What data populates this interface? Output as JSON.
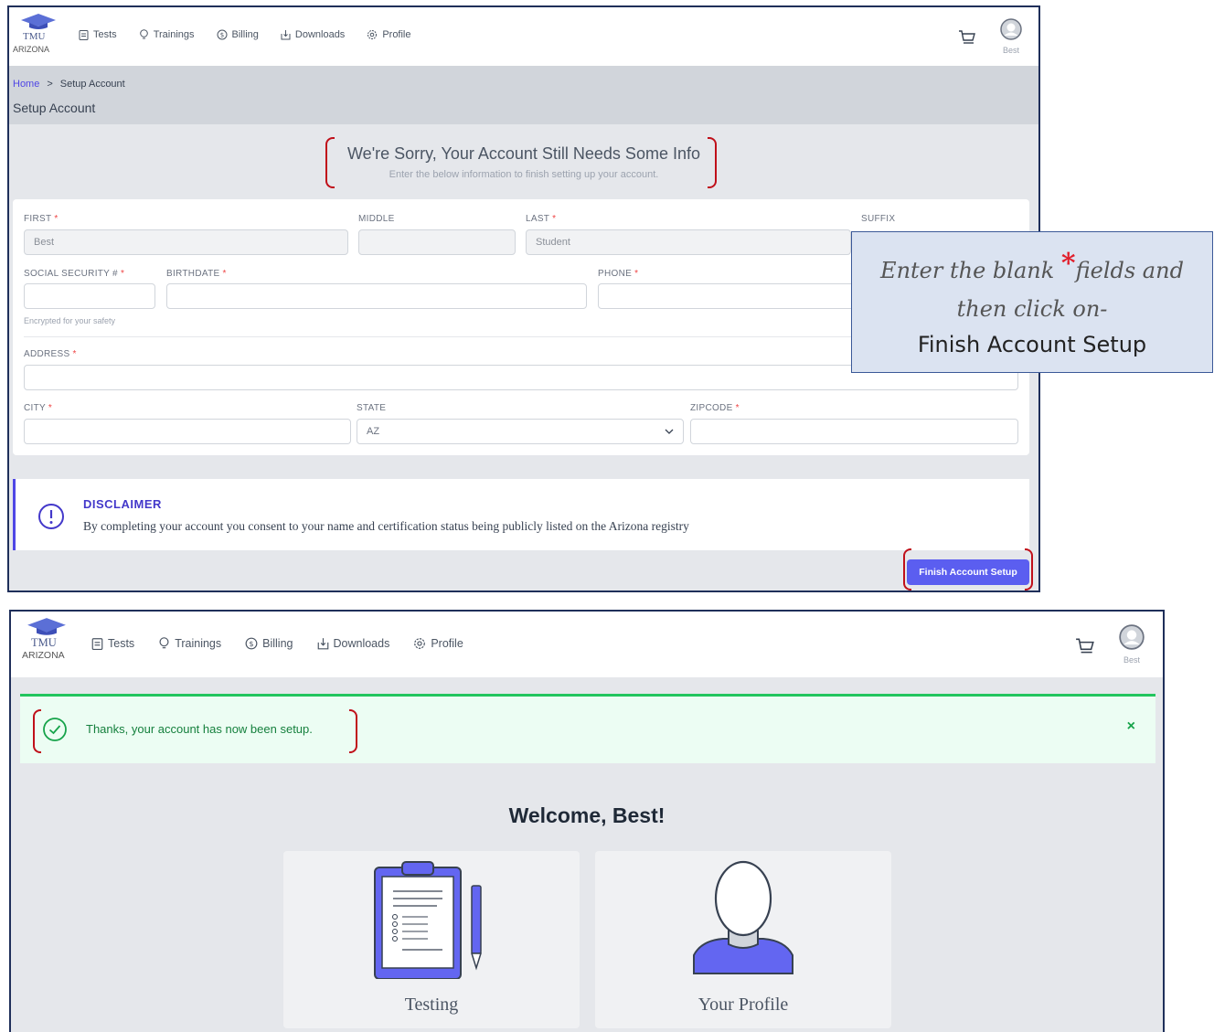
{
  "top": {
    "brand": {
      "name": "TMU",
      "state": "ARIZONA",
      "icon": "graduation-cap-icon"
    },
    "nav": [
      {
        "label": "Tests",
        "icon": "clipboard-icon"
      },
      {
        "label": "Trainings",
        "icon": "lightbulb-icon"
      },
      {
        "label": "Billing",
        "icon": "dollar-icon"
      },
      {
        "label": "Downloads",
        "icon": "download-icon"
      },
      {
        "label": "Profile",
        "icon": "gear-icon"
      }
    ],
    "user_name": "Best",
    "breadcrumb": {
      "home": "Home",
      "separator": ">",
      "current": "Setup Account"
    },
    "page_title": "Setup Account",
    "notice": {
      "heading": "We're Sorry, Your Account Still Needs Some Info",
      "sub": "Enter the below information to finish setting up your account."
    },
    "form": {
      "required_mark": "*",
      "first": {
        "label": "FIRST",
        "value": "Best"
      },
      "middle": {
        "label": "MIDDLE",
        "value": ""
      },
      "last": {
        "label": "LAST",
        "value": "Student"
      },
      "suffix": {
        "label": "SUFFIX",
        "value": ""
      },
      "ssn": {
        "label": "SOCIAL SECURITY #",
        "value": "",
        "helper": "Encrypted for your safety"
      },
      "birthdate": {
        "label": "BIRTHDATE",
        "value": ""
      },
      "phone": {
        "label": "PHONE",
        "value": ""
      },
      "address": {
        "label": "ADDRESS",
        "value": ""
      },
      "city": {
        "label": "CITY",
        "value": ""
      },
      "state": {
        "label": "STATE",
        "value": "AZ"
      },
      "zipcode": {
        "label": "ZIPCODE",
        "value": ""
      }
    },
    "disclaimer": {
      "title": "DISCLAIMER",
      "text": "By completing your account you consent to your name and certification status being publicly listed on the Arizona registry"
    },
    "finish_button": "Finish Account Setup"
  },
  "callout": {
    "line1_pre": "Enter the blank",
    "star": "*",
    "line1_post": "fields and",
    "line2": "then click on-",
    "line3": "Finish Account Setup"
  },
  "bottom": {
    "alert": {
      "message": "Thanks, your account has now been setup.",
      "close": "×"
    },
    "welcome": "Welcome, Best!",
    "tiles": [
      {
        "label": "Testing",
        "icon": "clipboard-pen-illustration"
      },
      {
        "label": "Your Profile",
        "icon": "person-illustration"
      }
    ]
  },
  "colors": {
    "accent": "#5b5ef0",
    "required": "#ef4444",
    "success": "#22c55e",
    "annotation": "#c0101a"
  }
}
